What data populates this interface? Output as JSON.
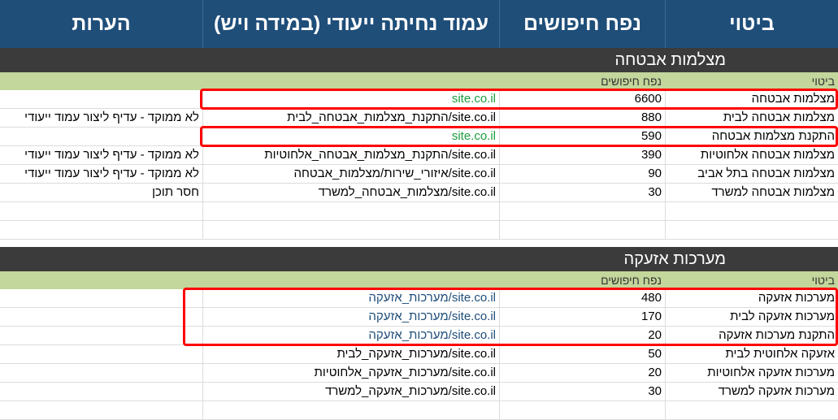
{
  "header": {
    "phrase": "ביטוי",
    "volume": "נפח חיפושים",
    "landing": "עמוד נחיתה ייעודי (במידה ויש)",
    "notes": "הערות"
  },
  "sections": [
    {
      "title": "מצלמות אבטחה",
      "sub_phrase": "ביטוי",
      "sub_volume": "נפח חיפושים",
      "rows": [
        {
          "phrase": "מצלמות אבטחה",
          "volume": "6600",
          "url": "site.co.il",
          "note": "",
          "url_color": "green"
        },
        {
          "phrase": "מצלמות אבטחה לבית",
          "volume": "880",
          "url": "site.co.il/התקנת_מצלמות_אבטחה_לבית",
          "note": "לא ממוקד - עדיף ליצור עמוד ייעודי",
          "url_color": "black"
        },
        {
          "phrase": "התקנת מצלמות אבטחה",
          "volume": "590",
          "url": "site.co.il",
          "note": "",
          "url_color": "green"
        },
        {
          "phrase": "מצלמות אבטחה אלחוטיות",
          "volume": "390",
          "url": "site.co.il/התקנת_מצלמות_אבטחה_אלחוטיות",
          "note": "לא ממוקד - עדיף ליצור עמוד ייעודי",
          "url_color": "black"
        },
        {
          "phrase": "מצלמות אבטחה בתל אביב",
          "volume": "90",
          "url": "site.co.il/איזורי_שירות/מצלמות_אבטחה",
          "note": "לא ממוקד - עדיף ליצור עמוד ייעודי",
          "url_color": "black"
        },
        {
          "phrase": "מצלמות אבטחה למשרד",
          "volume": "30",
          "url": "site.co.il/מצלמות_אבטחה_למשרד",
          "note": "חסר תוכן",
          "url_color": "black"
        },
        {
          "phrase": "",
          "volume": "",
          "url": "",
          "note": "",
          "url_color": "black"
        },
        {
          "phrase": "",
          "volume": "",
          "url": "",
          "note": "",
          "url_color": "black"
        }
      ]
    },
    {
      "title": "מערכות אזעקה",
      "sub_phrase": "ביטוי",
      "sub_volume": "נפח חיפושים",
      "rows": [
        {
          "phrase": "מערכות אזעקה",
          "volume": "480",
          "url": "site.co.il/מערכות_אזעקה",
          "note": "",
          "url_color": "blue"
        },
        {
          "phrase": "מערכות אזעקה לבית",
          "volume": "170",
          "url": "site.co.il/מערכות_אזעקה",
          "note": "",
          "url_color": "blue"
        },
        {
          "phrase": "התקנת מערכות אזעקה",
          "volume": "20",
          "url": "site.co.il/מערכות_אזעקה",
          "note": "",
          "url_color": "blue"
        },
        {
          "phrase": "אזעקה אלחוטית לבית",
          "volume": "50",
          "url": "site.co.il/מערכות_אזעקה_לבית",
          "note": "",
          "url_color": "black"
        },
        {
          "phrase": "מערכות אזעקה אלחוטיות",
          "volume": "20",
          "url": "site.co.il/מערכות_אזעקה_אלחוטיות",
          "note": "",
          "url_color": "black"
        },
        {
          "phrase": "מערכות אזעקה למשרד",
          "volume": "30",
          "url": "site.co.il/מערכות_אזעקה_למשרד",
          "note": "",
          "url_color": "black"
        },
        {
          "phrase": "",
          "volume": "",
          "url": "",
          "note": "",
          "url_color": "black"
        }
      ]
    }
  ],
  "colors": {
    "header_bg": "#1f4e79",
    "section_bg": "#3b3b3b",
    "subheader_bg": "#c3d69b",
    "highlight": "#ff0000",
    "url_green": "#1a9e3c",
    "url_blue": "#1f4e79"
  }
}
